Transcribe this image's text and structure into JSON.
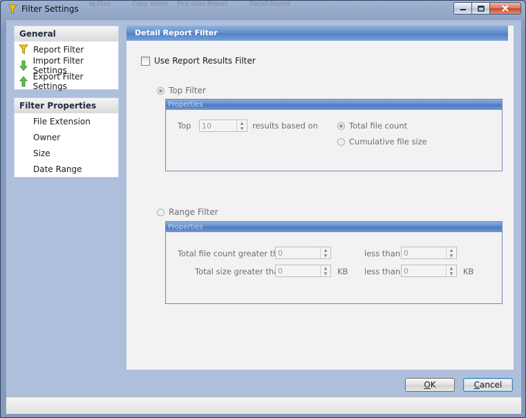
{
  "window": {
    "title": "Filter Settings",
    "ghost_tabs": [
      "Iq-Files",
      "Copy Vision",
      "Pick date Report",
      "Detail Report"
    ],
    "icons": {
      "title": "funnel-icon",
      "minimize": "minimize-icon",
      "maximize": "maximize-icon",
      "close": "close-icon"
    }
  },
  "sidebar": {
    "groups": [
      {
        "header": "General",
        "items": [
          {
            "label": "Report Filter",
            "icon": "funnel-icon"
          },
          {
            "label": "Import Filter Settings",
            "icon": "arrow-down-icon"
          },
          {
            "label": "Export Filter Settings",
            "icon": "arrow-up-icon"
          }
        ]
      },
      {
        "header": "Filter Properties",
        "items": [
          {
            "label": "File Extension"
          },
          {
            "label": "Owner"
          },
          {
            "label": "Size"
          },
          {
            "label": "Date Range"
          }
        ]
      }
    ]
  },
  "main": {
    "header": "Detail Report Filter",
    "use_results_filter": {
      "label": "Use Report Results Filter",
      "checked": false
    },
    "top_filter": {
      "label": "Top Filter",
      "selected": true,
      "properties_header": "Properties",
      "top_label": "Top",
      "top_value": "10",
      "based_on_label": "results based on",
      "options": [
        {
          "label": "Total file count",
          "selected": true
        },
        {
          "label": "Cumulative file size",
          "selected": false
        }
      ]
    },
    "range_filter": {
      "label": "Range Filter",
      "selected": false,
      "properties_header": "Properties",
      "count_gt_label": "Total file count greater than",
      "count_gt_value": "0",
      "count_lt_label": "less than",
      "count_lt_value": "0",
      "size_gt_label": "Total size greater than",
      "size_gt_value": "0",
      "size_unit": "KB",
      "size_lt_label": "less than",
      "size_lt_value": "0",
      "size_lt_unit": "KB"
    }
  },
  "buttons": {
    "ok_label": "OK",
    "ok_mnemonic_rest": "K",
    "ok_mnemonic": "O",
    "cancel_mnemonic": "C",
    "cancel_rest": "ancel"
  }
}
